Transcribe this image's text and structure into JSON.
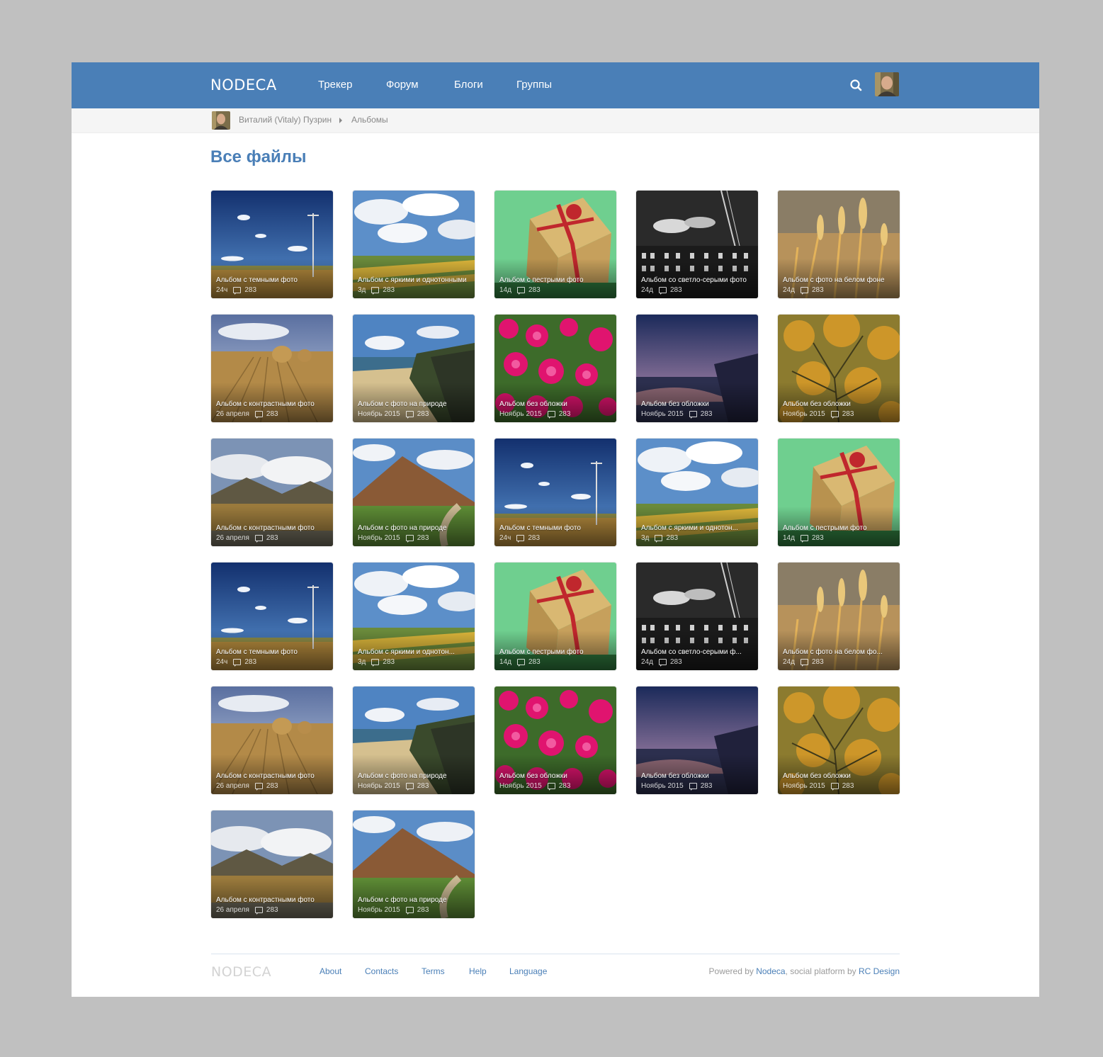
{
  "nav": {
    "logo": "NODECA",
    "links": [
      "Трекер",
      "Форум",
      "Блоги",
      "Группы"
    ],
    "search_icon": "search-icon",
    "avatar_icon": "user-avatar"
  },
  "breadcrumbs": {
    "user": "Виталий (Vitaly) Пузрин",
    "separator_icon": "triangle-right-icon",
    "current": "Альбомы"
  },
  "page": {
    "title": "Все файлы"
  },
  "albums": [
    {
      "title": "Альбом с темными фото",
      "date": "24ч",
      "comments": "283",
      "photo": "field-pole"
    },
    {
      "title": "Альбом с яркими и однотонными",
      "date": "3д",
      "comments": "283",
      "photo": "clouds-fields"
    },
    {
      "title": "Альбом с пестрыми фото",
      "date": "14д",
      "comments": "283",
      "photo": "gift-box"
    },
    {
      "title": "Альбом со светло-серыми фото",
      "date": "24д",
      "comments": "283",
      "photo": "bw-building"
    },
    {
      "title": "Альбом с фото на белом фоне",
      "date": "24д",
      "comments": "283",
      "photo": "wheat"
    },
    {
      "title": "Альбом с контрастными фото",
      "date": "26 апреля",
      "comments": "283",
      "photo": "hay-bales"
    },
    {
      "title": "Альбом с фото на природе",
      "date": "Ноябрь 2015",
      "comments": "283",
      "photo": "coast-cliff"
    },
    {
      "title": "Альбом без обложки",
      "date": "Ноябрь 2015",
      "comments": "283",
      "photo": "pink-flowers"
    },
    {
      "title": "Альбом без обложки",
      "date": "Ноябрь 2015",
      "comments": "283",
      "photo": "sunset-lake"
    },
    {
      "title": "Альбом без обложки",
      "date": "Ноябрь 2015",
      "comments": "283",
      "photo": "tree-branches"
    },
    {
      "title": "Альбом с контрастными фото",
      "date": "26 апреля",
      "comments": "283",
      "photo": "valley-clouds"
    },
    {
      "title": "Альбом с фото на природе",
      "date": "Ноябрь 2015",
      "comments": "283",
      "photo": "mountain-road"
    },
    {
      "title": "Альбом с темными фото",
      "date": "24ч",
      "comments": "283",
      "photo": "field-pole"
    },
    {
      "title": "Альбом с яркими и однотон...",
      "date": "3д",
      "comments": "283",
      "photo": "clouds-fields"
    },
    {
      "title": "Альбом с пестрыми фото",
      "date": "14д",
      "comments": "283",
      "photo": "gift-box"
    },
    {
      "title": "Альбом с темными фото",
      "date": "24ч",
      "comments": "283",
      "photo": "field-pole"
    },
    {
      "title": "Альбом с яркими и однотон...",
      "date": "3д",
      "comments": "283",
      "photo": "clouds-fields"
    },
    {
      "title": "Альбом с пестрыми фото",
      "date": "14д",
      "comments": "283",
      "photo": "gift-box"
    },
    {
      "title": "Альбом со светло-серыми ф...",
      "date": "24д",
      "comments": "283",
      "photo": "bw-building"
    },
    {
      "title": "Альбом с фото на белом фо...",
      "date": "24д",
      "comments": "283",
      "photo": "wheat"
    },
    {
      "title": "Альбом с контрастными фото",
      "date": "26 апреля",
      "comments": "283",
      "photo": "hay-bales"
    },
    {
      "title": "Альбом с фото на природе",
      "date": "Ноябрь 2015",
      "comments": "283",
      "photo": "coast-cliff"
    },
    {
      "title": "Альбом без обложки",
      "date": "Ноябрь 2015",
      "comments": "283",
      "photo": "pink-flowers"
    },
    {
      "title": "Альбом без обложки",
      "date": "Ноябрь 2015",
      "comments": "283",
      "photo": "sunset-lake"
    },
    {
      "title": "Альбом без обложки",
      "date": "Ноябрь 2015",
      "comments": "283",
      "photo": "tree-branches"
    },
    {
      "title": "Альбом с контрастными фото",
      "date": "26 апреля",
      "comments": "283",
      "photo": "valley-clouds"
    },
    {
      "title": "Альбом с фото на природе",
      "date": "Ноябрь 2015",
      "comments": "283",
      "photo": "mountain-road"
    }
  ],
  "footer": {
    "logo": "NODECA",
    "links": [
      "About",
      "Contacts",
      "Terms",
      "Help",
      "Language"
    ],
    "powered_prefix": "Powered by ",
    "powered_link": "Nodeca",
    "powered_middle": ", social platform by ",
    "powered_link2": "RC Design"
  },
  "colors": {
    "brand": "#4a7fb7",
    "page_bg": "#c0c0c0",
    "breadcrumb_bg": "#f5f5f5"
  }
}
